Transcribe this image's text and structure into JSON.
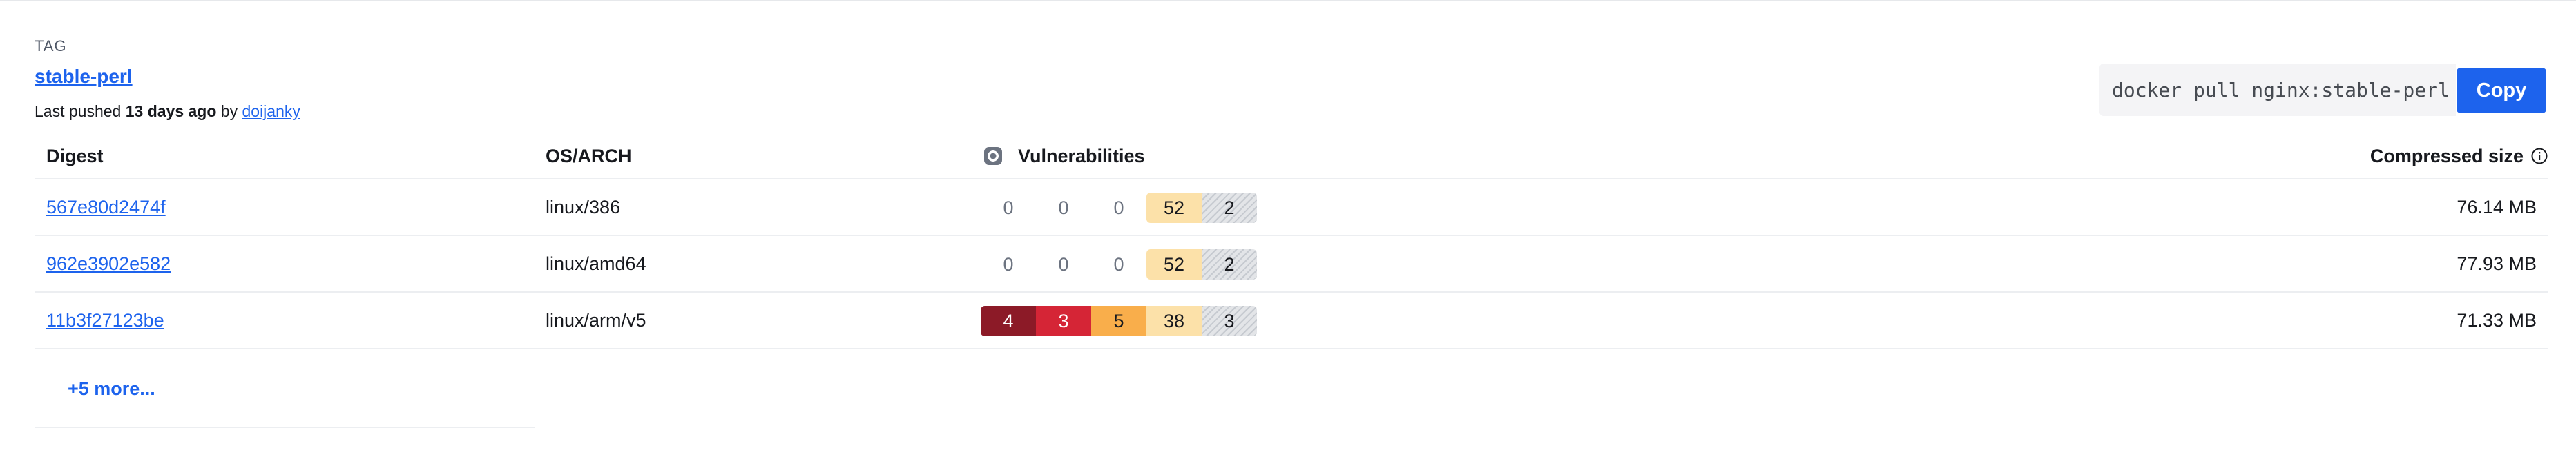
{
  "header": {
    "tag_label": "TAG",
    "tag_name": "stable-perl",
    "last_pushed_prefix": "Last pushed",
    "last_pushed_time": "13 days ago",
    "by_text": "by",
    "pushed_by": "doijanky"
  },
  "pull": {
    "command": "docker pull nginx:stable-perl",
    "copy_label": "Copy"
  },
  "table": {
    "columns": {
      "digest": "Digest",
      "os_arch": "OS/ARCH",
      "vulnerabilities": "Vulnerabilities",
      "compressed_size": "Compressed size"
    },
    "rows": [
      {
        "digest": "567e80d2474f",
        "os_arch": "linux/386",
        "vulns": {
          "critical": "0",
          "high": "0",
          "medium": "0",
          "low": "52",
          "unspecified": "2"
        },
        "size": "76.14 MB"
      },
      {
        "digest": "962e3902e582",
        "os_arch": "linux/amd64",
        "vulns": {
          "critical": "0",
          "high": "0",
          "medium": "0",
          "low": "52",
          "unspecified": "2"
        },
        "size": "77.93 MB"
      },
      {
        "digest": "11b3f27123be",
        "os_arch": "linux/arm/v5",
        "vulns": {
          "critical": "4",
          "high": "3",
          "medium": "5",
          "low": "38",
          "unspecified": "3"
        },
        "size": "71.33 MB"
      }
    ],
    "more_label": "+5 more..."
  },
  "colors": {
    "accent": "#1d63ed",
    "critical": "#8c1a27",
    "high": "#d52536",
    "medium": "#f9ae4b",
    "low": "#fce1a9",
    "unspecified": "#e3e5e8"
  },
  "icons": {
    "vulnerabilities": "scout-shield-icon",
    "info": "info-circle-icon"
  }
}
